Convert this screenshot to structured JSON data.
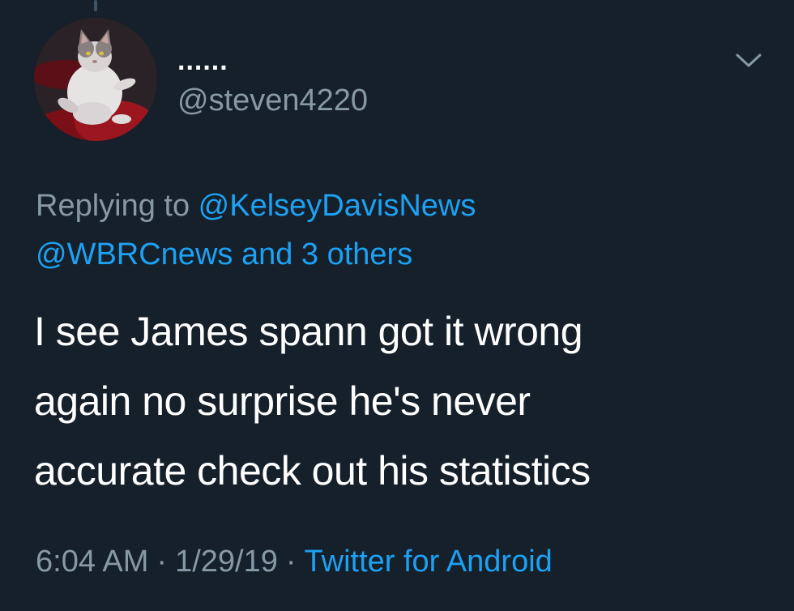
{
  "tweet": {
    "display_name": "......",
    "handle": "@steven4220",
    "replying_prefix": "Replying to ",
    "replying_to_primary": "@KelseyDavisNews",
    "replying_to_secondary": "@WBRCnews and 3 others",
    "text_lines": [
      "I see James spann got it wrong",
      "again no surprise he's never",
      "accurate check out his statistics"
    ],
    "time": "6:04 AM",
    "date": "1/29/19",
    "separator": "·",
    "source": "Twitter for Android"
  },
  "icons": {
    "caret": "chevron-down-icon",
    "avatar": "cat-avatar"
  },
  "colors": {
    "background": "#15202b",
    "text": "#ffffff",
    "muted": "#8899a6",
    "link": "#1da1f2"
  }
}
